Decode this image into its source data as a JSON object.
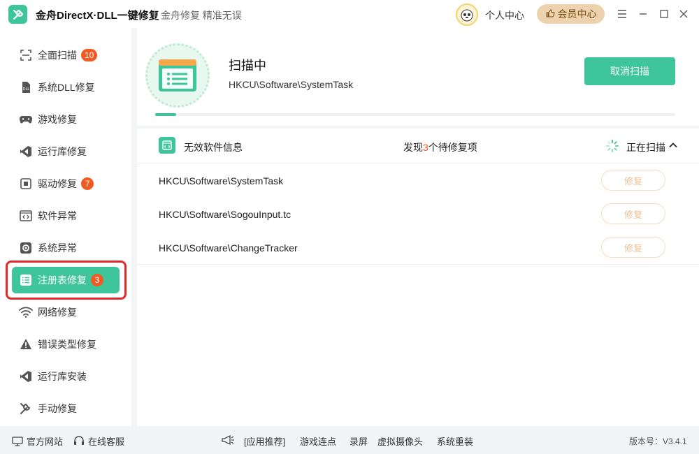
{
  "app": {
    "name": "金舟DirectX·DLL一键修复",
    "slogan": "金舟修复 精准无误",
    "user_center": "个人中心",
    "vip_label": "会员中心"
  },
  "sidebar": {
    "items": [
      {
        "label": "全面扫描",
        "badge": "10",
        "icon": "scan-icon"
      },
      {
        "label": "系统DLL修复",
        "badge": "",
        "icon": "dll-icon"
      },
      {
        "label": "游戏修复",
        "badge": "",
        "icon": "gamepad-icon"
      },
      {
        "label": "运行库修复",
        "badge": "",
        "icon": "runtime-icon"
      },
      {
        "label": "驱动修复",
        "badge": "7",
        "icon": "driver-icon"
      },
      {
        "label": "软件异常",
        "badge": "",
        "icon": "code-icon"
      },
      {
        "label": "系统异常",
        "badge": "",
        "icon": "gear-icon"
      },
      {
        "label": "注册表修复",
        "badge": "3",
        "icon": "list-icon",
        "active": true
      },
      {
        "label": "网络修复",
        "badge": "",
        "icon": "wifi-icon"
      },
      {
        "label": "错误类型修复",
        "badge": "",
        "icon": "warning-icon"
      },
      {
        "label": "运行库安装",
        "badge": "",
        "icon": "runtime-install-icon"
      },
      {
        "label": "手动修复",
        "badge": "",
        "icon": "wrench-icon"
      }
    ]
  },
  "scan": {
    "title": "扫描中",
    "current_path": "HKCU\\Software\\SystemTask",
    "cancel_label": "取消扫描",
    "progress": 0.04
  },
  "results": {
    "category": "无效软件信息",
    "found_prefix": "发现",
    "found_count": "3",
    "found_suffix": "个待修复项",
    "status": "正在扫描",
    "rows": [
      {
        "path": "HKCU\\Software\\SystemTask",
        "action": "修复"
      },
      {
        "path": "HKCU\\Software\\SogouInput.tc",
        "action": "修复"
      },
      {
        "path": "HKCU\\Software\\ChangeTracker",
        "action": "修复"
      }
    ]
  },
  "footer": {
    "website": "官方网站",
    "support": "在线客服",
    "recommend": "[应用推荐]",
    "links": [
      "游戏连点",
      "录屏",
      "虚拟摄像头",
      "系统重装"
    ],
    "version": "版本号：V3.4.1"
  },
  "colors": {
    "accent": "#3fc59a",
    "badge": "#f15a22",
    "highlight": "#e02b2b",
    "vip": "#ecd3ad"
  }
}
